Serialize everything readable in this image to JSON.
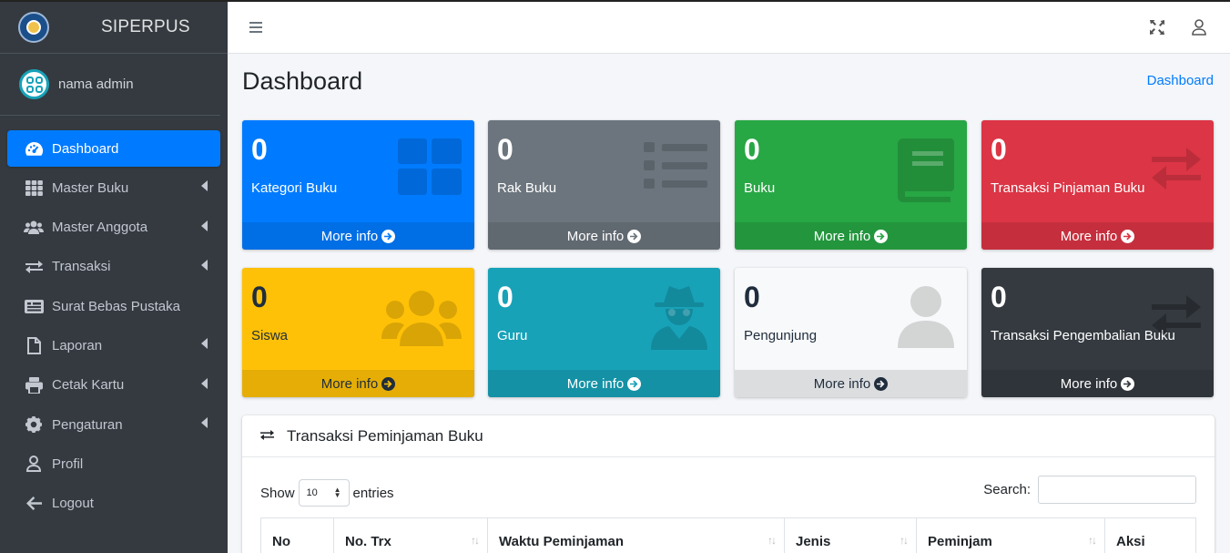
{
  "brand": {
    "name": "SIPERPUS"
  },
  "user": {
    "name": "nama admin"
  },
  "sidebar": {
    "items": [
      {
        "label": "Dashboard",
        "icon": "tachometer-icon",
        "active": true,
        "has_submenu": false
      },
      {
        "label": "Master Buku",
        "icon": "grid-icon",
        "active": false,
        "has_submenu": true
      },
      {
        "label": "Master Anggota",
        "icon": "users-icon",
        "active": false,
        "has_submenu": true
      },
      {
        "label": "Transaksi",
        "icon": "exchange-icon",
        "active": false,
        "has_submenu": true
      },
      {
        "label": "Surat Bebas Pustaka",
        "icon": "id-card-icon",
        "active": false,
        "has_submenu": false
      },
      {
        "label": "Laporan",
        "icon": "file-icon",
        "active": false,
        "has_submenu": true
      },
      {
        "label": "Cetak Kartu",
        "icon": "printer-icon",
        "active": false,
        "has_submenu": true
      },
      {
        "label": "Pengaturan",
        "icon": "gear-icon",
        "active": false,
        "has_submenu": true
      },
      {
        "label": "Profil",
        "icon": "user-icon",
        "active": false,
        "has_submenu": false
      },
      {
        "label": "Logout",
        "icon": "arrow-left-icon",
        "active": false,
        "has_submenu": false
      }
    ]
  },
  "header": {
    "menu_icon": "hamburger-icon",
    "fullscreen_icon": "expand-icon",
    "user_icon": "user-icon"
  },
  "page": {
    "title": "Dashboard",
    "breadcrumb": "Dashboard"
  },
  "boxes": [
    {
      "value": "0",
      "label": "Kategori Buku",
      "footer": "More info",
      "color": "#007bff",
      "icon": "grid-icon"
    },
    {
      "value": "0",
      "label": "Rak Buku",
      "footer": "More info",
      "color": "#6c757d",
      "icon": "list-icon"
    },
    {
      "value": "0",
      "label": "Buku",
      "footer": "More info",
      "color": "#28a745",
      "icon": "book-icon"
    },
    {
      "value": "0",
      "label": "Transaksi Pinjaman Buku",
      "footer": "More info",
      "color": "#dc3545",
      "icon": "exchange-icon"
    },
    {
      "value": "0",
      "label": "Siswa",
      "footer": "More info",
      "color": "#ffc107",
      "icon": "users-icon"
    },
    {
      "value": "0",
      "label": "Guru",
      "footer": "More info",
      "color": "#17a2b8",
      "icon": "user-secret-icon"
    },
    {
      "value": "0",
      "label": "Pengunjung",
      "footer": "More info",
      "color": "#f8f9fa",
      "icon": "user-icon"
    },
    {
      "value": "0",
      "label": "Transaksi Pengembalian Buku",
      "footer": "More info",
      "color": "#343a40",
      "icon": "exchange-icon"
    }
  ],
  "card": {
    "title": "Transaksi Peminjaman Buku",
    "show_label": "Show",
    "entries_label": "entries",
    "page_size": "10",
    "search_label": "Search:",
    "columns": [
      "No",
      "No. Trx",
      "Waktu Peminjaman",
      "Jenis",
      "Peminjam",
      "Aksi"
    ]
  }
}
